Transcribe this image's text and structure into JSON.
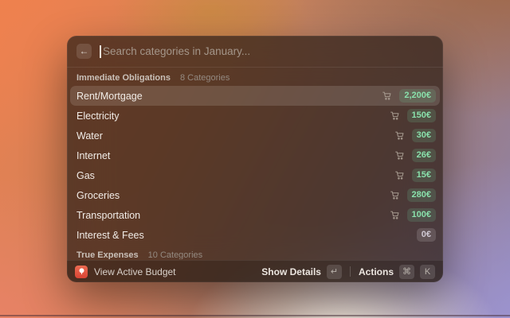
{
  "window": {
    "search": {
      "placeholder": "Search categories in January...",
      "back_glyph": "←"
    },
    "section": {
      "title": "Immediate Obligations",
      "count": "8 Categories"
    },
    "rows": [
      {
        "label": "Rent/Mortgage",
        "amount": "2,200€",
        "cart": true,
        "selected": true,
        "badge": "green"
      },
      {
        "label": "Electricity",
        "amount": "150€",
        "cart": true,
        "selected": false,
        "badge": "green"
      },
      {
        "label": "Water",
        "amount": "30€",
        "cart": true,
        "selected": false,
        "badge": "green"
      },
      {
        "label": "Internet",
        "amount": "26€",
        "cart": true,
        "selected": false,
        "badge": "green"
      },
      {
        "label": "Gas",
        "amount": "15€",
        "cart": true,
        "selected": false,
        "badge": "green"
      },
      {
        "label": "Groceries",
        "amount": "280€",
        "cart": true,
        "selected": false,
        "badge": "green"
      },
      {
        "label": "Transportation",
        "amount": "100€",
        "cart": true,
        "selected": false,
        "badge": "green"
      },
      {
        "label": "Interest & Fees",
        "amount": "0€",
        "cart": false,
        "selected": false,
        "badge": "gray"
      }
    ],
    "next_section": {
      "title": "True Expenses",
      "count": "10 Categories"
    },
    "footer": {
      "app_label": "View Active Budget",
      "primary_action": "Show Details",
      "primary_key": "↵",
      "actions_label": "Actions",
      "actions_keys": [
        "⌘",
        "K"
      ]
    }
  },
  "colors": {
    "badge_green_text": "#89e0ab",
    "badge_gray_text": "#cfc9d3",
    "app_icon_red": "#d94434"
  }
}
